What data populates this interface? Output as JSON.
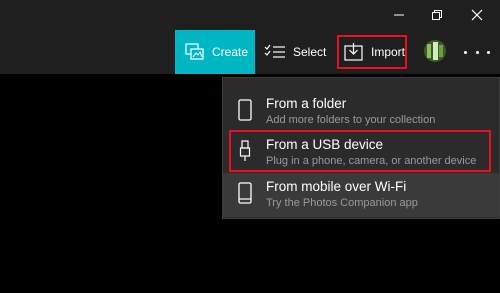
{
  "window_controls": {
    "minimize_icon": "minimize-icon",
    "restore_icon": "restore-icon",
    "close_icon": "close-icon"
  },
  "toolbar": {
    "create_label": "Create",
    "select_label": "Select",
    "import_label": "Import",
    "accent_color": "#00b7c3",
    "highlight_color": "#e81123"
  },
  "import_menu": {
    "items": [
      {
        "title": "From a folder",
        "subtitle": "Add more folders to your collection",
        "icon": "folder-icon"
      },
      {
        "title": "From a USB device",
        "subtitle": "Plug in a phone, camera, or another device",
        "icon": "usb-icon"
      },
      {
        "title": "From mobile over Wi-Fi",
        "subtitle": "Try the Photos Companion app",
        "icon": "phone-icon"
      }
    ]
  }
}
